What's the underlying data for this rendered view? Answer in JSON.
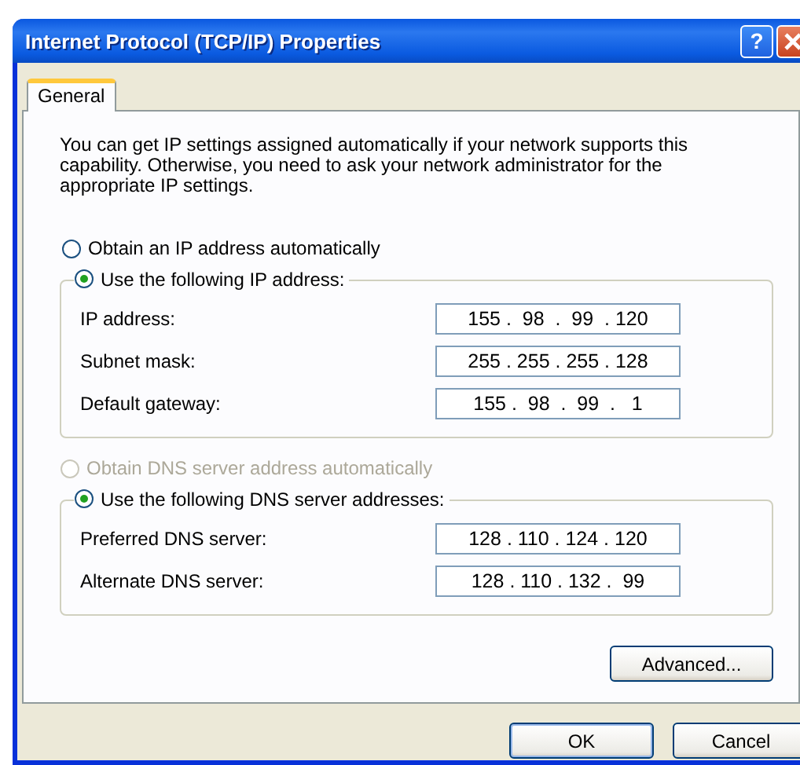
{
  "window": {
    "title": "Internet Protocol (TCP/IP) Properties",
    "help_button": "?"
  },
  "tabs": [
    {
      "label": "General",
      "selected": true
    }
  ],
  "intro": "You can get IP settings assigned automatically if your network supports this capability. Otherwise, you need to ask your network administrator for the appropriate IP settings.",
  "ip_options": [
    {
      "label": "Obtain an IP address automatically",
      "selected": false,
      "disabled": false
    },
    {
      "label": "Use the following IP address:",
      "selected": true,
      "disabled": false
    }
  ],
  "ip_fields": [
    {
      "label": "IP address:",
      "value": "155 .  98  .  99  . 120"
    },
    {
      "label": "Subnet mask:",
      "value": "255 . 255 . 255 . 128"
    },
    {
      "label": "Default gateway:",
      "value": "155 .  98  .  99  .   1"
    }
  ],
  "dns_options": [
    {
      "label": "Obtain DNS server address automatically",
      "selected": false,
      "disabled": true
    },
    {
      "label": "Use the following DNS server addresses:",
      "selected": true,
      "disabled": false
    }
  ],
  "dns_fields": [
    {
      "label": "Preferred DNS server:",
      "value": "128 . 110 . 124 . 120"
    },
    {
      "label": "Alternate DNS server:",
      "value": "128 . 110 . 132 .  99"
    }
  ],
  "advanced_button": "Advanced...",
  "buttons": [
    "OK",
    "Cancel"
  ]
}
